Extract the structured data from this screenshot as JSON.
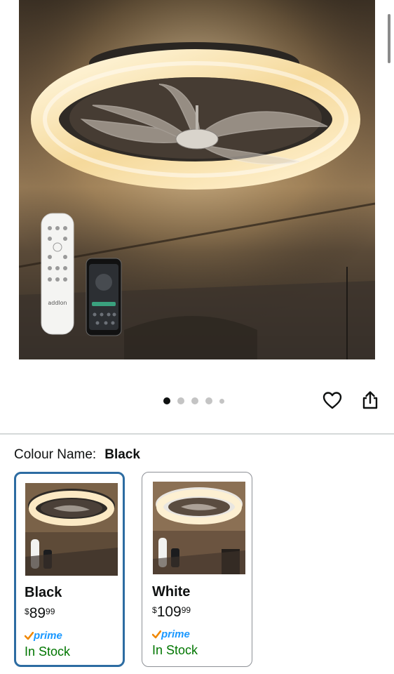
{
  "product_gallery": {
    "image_alt": "Ceiling fan with crystal LED ring light",
    "remote_brand": "addlon",
    "dots_count": 5,
    "active_dot_index": 0
  },
  "actions": {
    "favorite_icon": "heart-icon",
    "share_icon": "share-icon"
  },
  "colour_selector": {
    "label": "Colour Name:",
    "selected_value": "Black",
    "options": [
      {
        "name": "Black",
        "price_symbol": "$",
        "price_whole": "89",
        "price_fraction": "99",
        "prime_label": "prime",
        "stock": "In Stock",
        "selected": true
      },
      {
        "name": "White",
        "price_symbol": "$",
        "price_whole": "109",
        "price_fraction": "99",
        "prime_label": "prime",
        "stock": "In Stock",
        "selected": false
      }
    ]
  },
  "colors": {
    "selected_border": "#2d6ca2",
    "in_stock": "#007600",
    "prime_blue": "#1a98ff",
    "prime_check": "#f08804"
  }
}
